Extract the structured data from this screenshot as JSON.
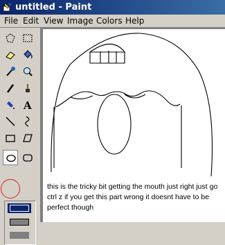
{
  "window": {
    "title": "untitled - Paint",
    "colors": {
      "titlebar_start": "#0a246a",
      "titlebar_end": "#3a6ea5",
      "chrome": "#d4d0c8",
      "selection_ring": "#e02020"
    }
  },
  "menu": {
    "file": "File",
    "edit": "Edit",
    "view": "View",
    "image": "Image",
    "colors": "Colors",
    "help": "Help"
  },
  "tools": [
    {
      "icon": "free-select-icon"
    },
    {
      "icon": "rect-select-icon"
    },
    {
      "icon": "eraser-icon"
    },
    {
      "icon": "fill-bucket-icon"
    },
    {
      "icon": "color-picker-icon"
    },
    {
      "icon": "magnifier-icon"
    },
    {
      "icon": "pencil-icon"
    },
    {
      "icon": "brush-icon"
    },
    {
      "icon": "airbrush-icon"
    },
    {
      "icon": "text-icon"
    },
    {
      "icon": "line-icon"
    },
    {
      "icon": "curve-icon"
    },
    {
      "icon": "rectangle-icon"
    },
    {
      "icon": "polygon-icon"
    },
    {
      "icon": "ellipse-icon",
      "selected": true
    },
    {
      "icon": "rounded-rect-icon"
    }
  ],
  "canvas": {
    "caption": "this is the tricky bit getting the mouth just right just go ctrl z if you get this part wrong it doesnt have to be perfect though"
  }
}
